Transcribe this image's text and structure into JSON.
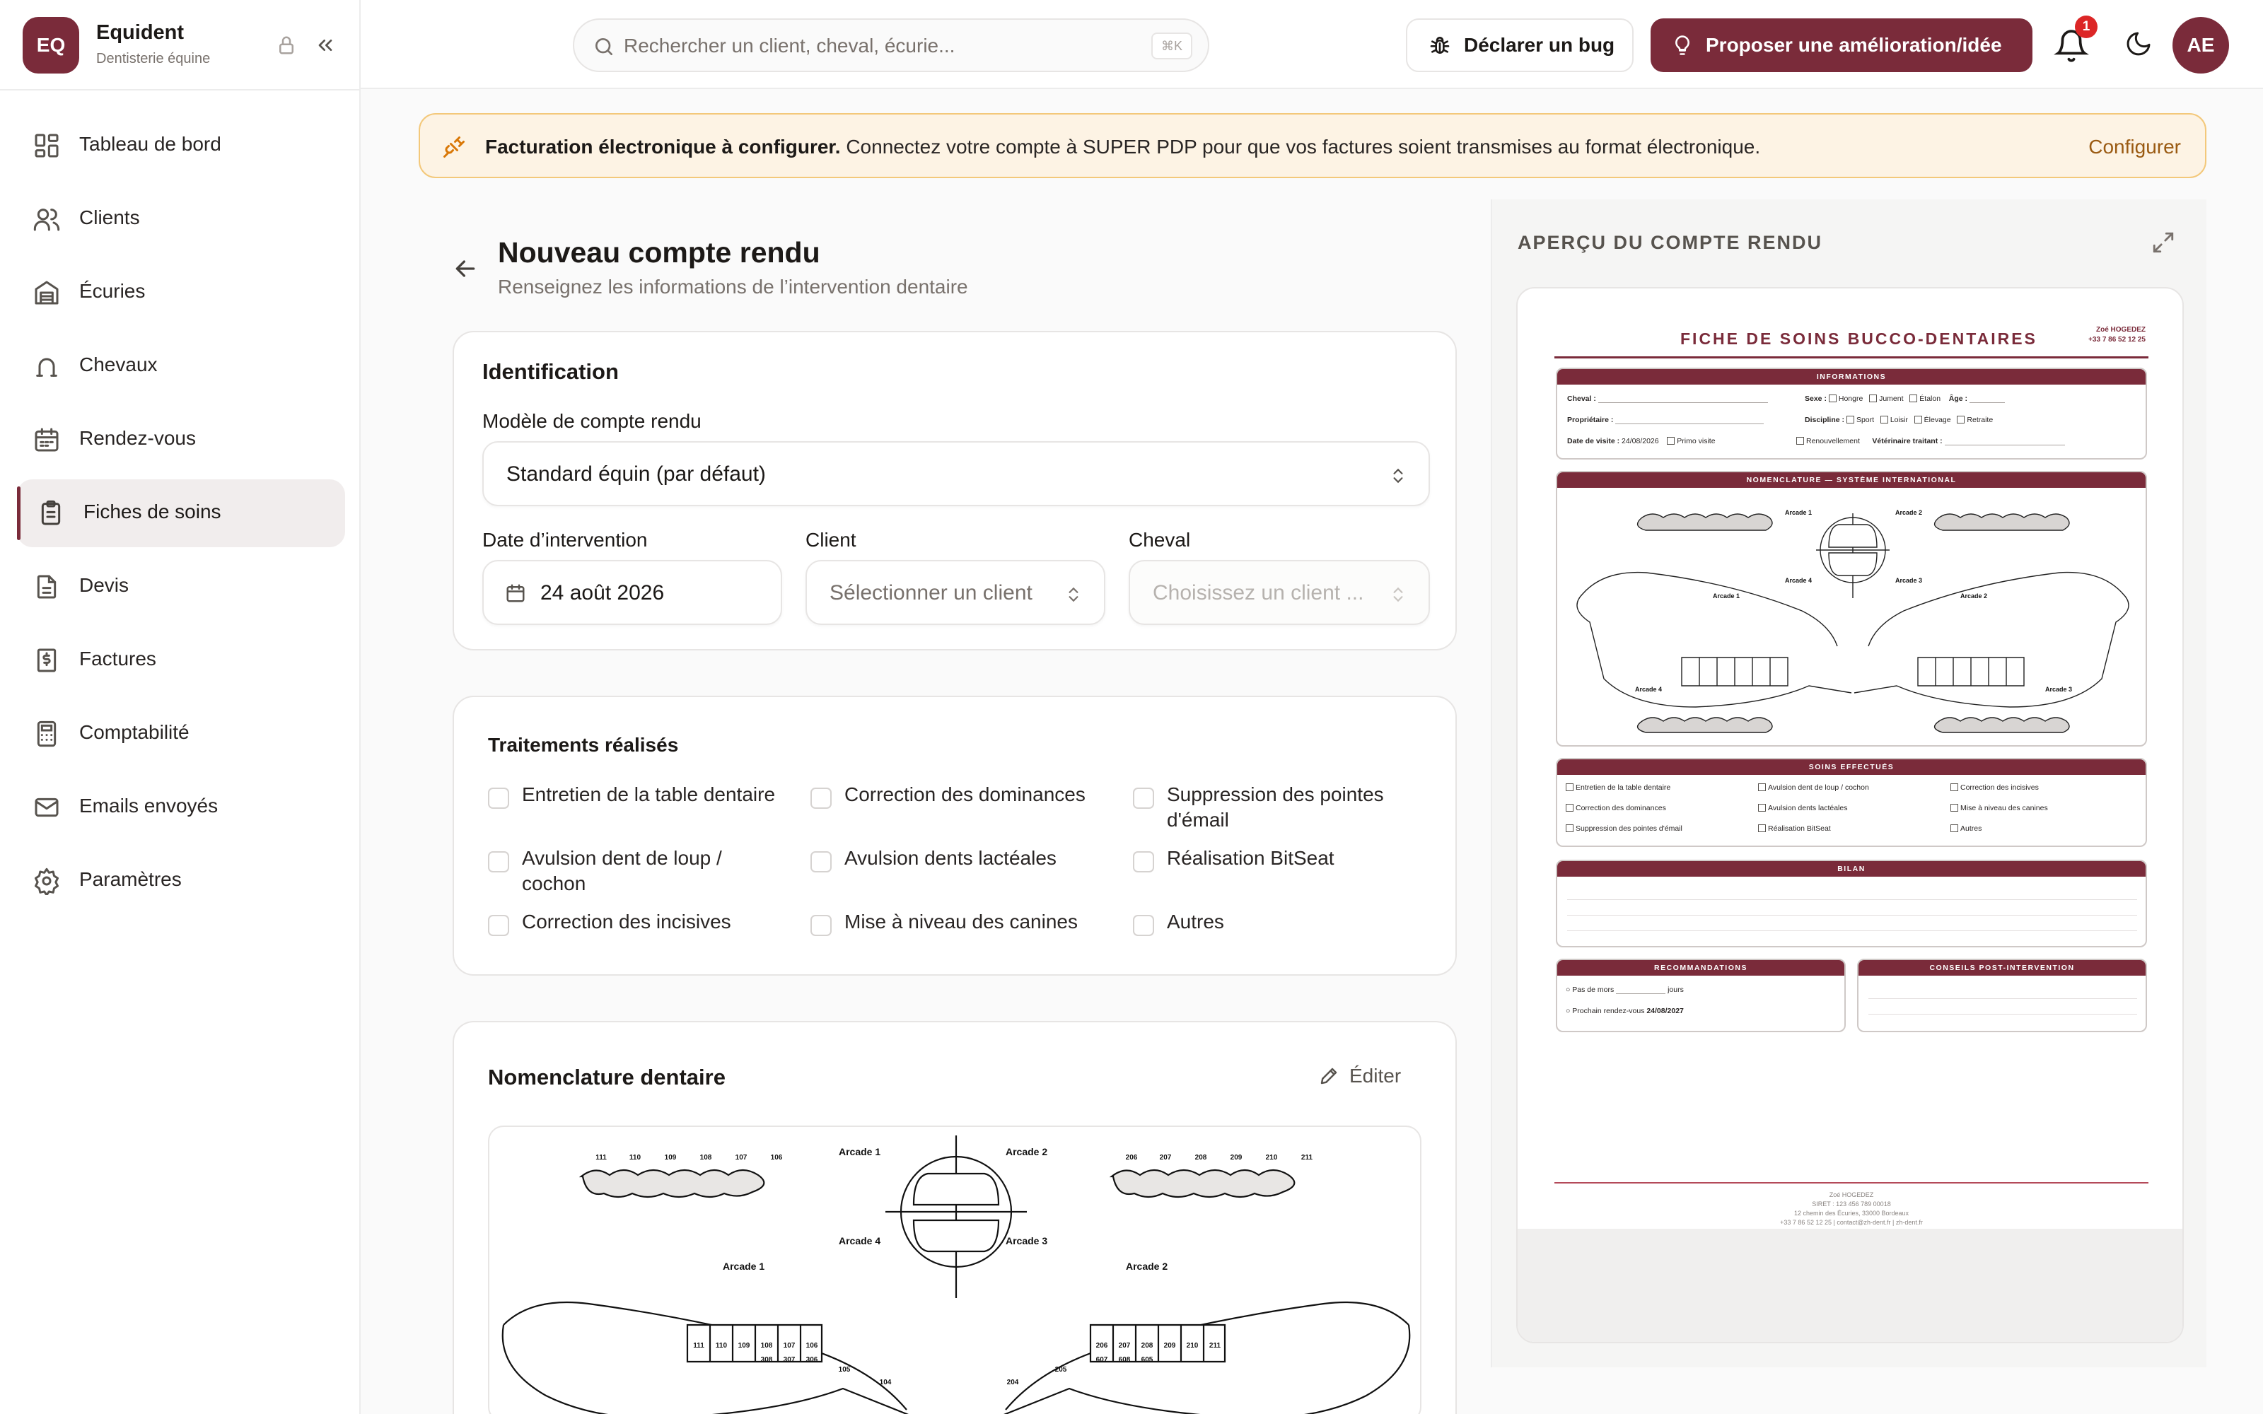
{
  "brand": {
    "initials": "EQ",
    "name": "Equident",
    "subtitle": "Dentisterie équine"
  },
  "sidebar": {
    "items": [
      {
        "label": "Tableau de bord",
        "icon": "dashboard-icon"
      },
      {
        "label": "Clients",
        "icon": "users-icon"
      },
      {
        "label": "Écuries",
        "icon": "building-icon"
      },
      {
        "label": "Chevaux",
        "icon": "horseshoe-icon"
      },
      {
        "label": "Rendez-vous",
        "icon": "calendar-icon"
      },
      {
        "label": "Fiches de soins",
        "icon": "clipboard-icon",
        "active": true
      },
      {
        "label": "Devis",
        "icon": "document-icon"
      },
      {
        "label": "Factures",
        "icon": "invoice-icon"
      },
      {
        "label": "Comptabilité",
        "icon": "calculator-icon"
      },
      {
        "label": "Emails envoyés",
        "icon": "mail-icon"
      },
      {
        "label": "Paramètres",
        "icon": "settings-icon"
      }
    ]
  },
  "topbar": {
    "search_placeholder": "Rechercher un client, cheval, écurie...",
    "search_shortcut": "⌘K",
    "bug_label": "Déclarer un bug",
    "idea_label": "Proposer une amélioration/idée",
    "notif_count": "1",
    "user_initials": "AE"
  },
  "banner": {
    "title": "Facturation électronique à configurer.",
    "text": "Connectez votre compte à SUPER PDP pour que vos factures soient transmises au format électronique.",
    "action": "Configurer"
  },
  "page": {
    "title": "Nouveau compte rendu",
    "subtitle": "Renseignez les informations de l’intervention dentaire"
  },
  "identification": {
    "title": "Identification",
    "model_label": "Modèle de compte rendu",
    "model_value": "Standard équin (par défaut)",
    "date_label": "Date d’intervention",
    "date_value": "24 août 2026",
    "client_label": "Client",
    "client_placeholder": "Sélectionner un client",
    "horse_label": "Cheval",
    "horse_placeholder": "Choisissez un client ..."
  },
  "treatments": {
    "title": "Traitements réalisés",
    "items": [
      "Entretien de la table dentaire",
      "Correction des dominances",
      "Suppression des pointes d'émail",
      "Avulsion dent de loup / cochon",
      "Avulsion dents lactéales",
      "Réalisation BitSeat",
      "Correction des incisives",
      "Mise à niveau des canines",
      "Autres"
    ]
  },
  "nomenclature": {
    "title": "Nomenclature dentaire",
    "edit_label": "Éditer",
    "arcade_labels": [
      "Arcade 1",
      "Arcade 2",
      "Arcade 4",
      "Arcade 3"
    ],
    "upper_right_teeth": [
      "111",
      "110",
      "109",
      "108",
      "107",
      "106"
    ],
    "upper_left_teeth": [
      "206",
      "207",
      "208",
      "209",
      "210",
      "211"
    ],
    "lower_right_teeth": [
      "111",
      "110",
      "109",
      "108",
      "107",
      "106"
    ],
    "lower_left_teeth": [
      "206",
      "207",
      "208",
      "209",
      "210",
      "211"
    ],
    "lower_right_sub": [
      "308",
      "307",
      "306",
      "105",
      "104"
    ],
    "lower_left_sub": [
      "204",
      "205",
      "607",
      "608",
      "605"
    ]
  },
  "preview": {
    "title": "APERÇU DU COMPTE RENDU",
    "doc_title": "FICHE DE SOINS BUCCO-DENTAIRES",
    "doc_owner": "Zoé HOGEDEZ",
    "doc_phone": "+33 7 86 52 12 25",
    "info_head": "INFORMATIONS",
    "info_horse": "Cheval :",
    "info_sex": "Sexe :",
    "info_sex_opts": [
      "Hongre",
      "Jument",
      "Étalon"
    ],
    "info_age": "Âge :",
    "info_owner": "Propriétaire :",
    "info_discipline": "Discipline :",
    "info_disc_opts": [
      "Sport",
      "Loisir",
      "Élevage",
      "Retraite"
    ],
    "info_date_label": "Date de visite :",
    "info_date": "24/08/2026",
    "info_first": "Primo visite",
    "info_renew": "Renouvellement",
    "info_vet": "Vétérinaire traitant :",
    "nom_head": "NOMENCLATURE — SYSTÈME INTERNATIONAL",
    "soins_head": "SOINS EFFECTUÉS",
    "soins": [
      "Entretien de la table dentaire",
      "Avulsion dent de loup / cochon",
      "Correction des incisives",
      "Correction des dominances",
      "Avulsion dents lactéales",
      "Mise à niveau des canines",
      "Suppression des pointes d'émail",
      "Réalisation BitSeat",
      "Autres"
    ],
    "bilan_head": "BILAN",
    "reco_head": "RECOMMANDATIONS",
    "reco_1a": "Pas de mors",
    "reco_1b": "jours",
    "reco_2": "Prochain rendez-vous",
    "reco_date": "24/08/2027",
    "conseils_head": "CONSEILS POST-INTERVENTION",
    "footer": [
      "Zoé HOGEDEZ",
      "SIRET : 123 456 789 00018",
      "12 chemin des Écuries, 33000 Bordeaux",
      "+33 7 86 52 12 25 | contact@zh-dent.fr | zh-dent.fr"
    ]
  },
  "colors": {
    "brand": "#7a2b3a",
    "banner_bg": "#fdf3e4",
    "banner_border": "#f3c87a",
    "badge": "#dc2626"
  }
}
